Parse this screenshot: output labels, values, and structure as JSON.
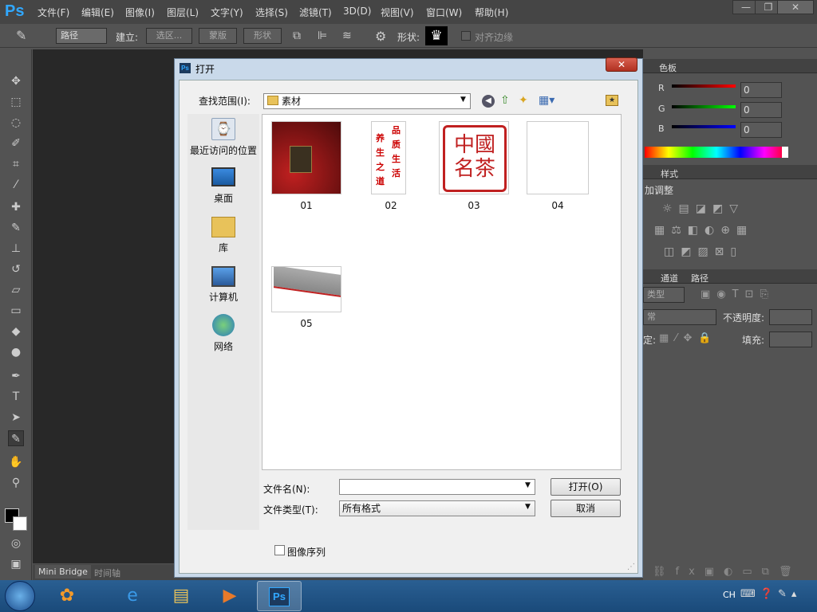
{
  "app": {
    "logo": "Ps"
  },
  "menu": [
    "文件(F)",
    "编辑(E)",
    "图像(I)",
    "图层(L)",
    "文字(Y)",
    "选择(S)",
    "滤镜(T)",
    "3D(D)",
    "视图(V)",
    "窗口(W)",
    "帮助(H)"
  ],
  "options": {
    "mode": "路径",
    "make": "建立:",
    "selection": "选区...",
    "mask": "蒙版",
    "shape": "形状",
    "shape_label": "形状:",
    "align_edges": "对齐边缘"
  },
  "tabs": {
    "mini_bridge": "Mini Bridge",
    "timeline": "时间轴"
  },
  "right_panel": {
    "tab_color": "色板",
    "r": "R",
    "g": "G",
    "b": "B",
    "r_val": "0",
    "g_val": "0",
    "b_val": "0",
    "tab_styles": "样式",
    "adjust_title": "加调整",
    "tab_channels": "通道",
    "tab_paths": "路径",
    "kind": "类型",
    "blend": "常",
    "opacity": "不透明度:",
    "lock": "定:",
    "fill": "填充:"
  },
  "dialog": {
    "title": "打开",
    "lookin_label": "查找范围(I):",
    "folder": "素材",
    "places": [
      "最近访问的位置",
      "桌面",
      "库",
      "计算机",
      "网络"
    ],
    "files": [
      "01",
      "02",
      "03",
      "04",
      "05"
    ],
    "filename_label": "文件名(N):",
    "filetype_label": "文件类型(T):",
    "filetype_value": "所有格式",
    "open_button": "打开(O)",
    "cancel_button": "取消",
    "image_sequence": "图像序列",
    "thumb02_text": [
      "品",
      "质",
      "生",
      "活",
      "养",
      "生",
      "之",
      "道"
    ],
    "thumb03_text": "中國名茶"
  },
  "taskbar": {
    "lang": "CH"
  }
}
